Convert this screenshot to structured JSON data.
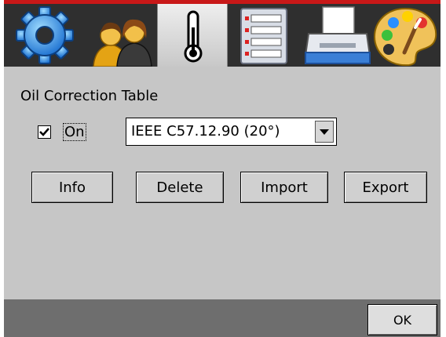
{
  "toolbar": {
    "tabs": [
      {
        "icon": "gear-icon",
        "active": false
      },
      {
        "icon": "users-icon",
        "active": false
      },
      {
        "icon": "thermometer-icon",
        "active": true
      },
      {
        "icon": "list-icon",
        "active": false
      },
      {
        "icon": "printer-icon",
        "active": false
      },
      {
        "icon": "palette-icon",
        "active": false
      }
    ]
  },
  "main": {
    "section_title": "Oil Correction Table",
    "on_checkbox": {
      "label": "On",
      "checked": true
    },
    "standard_select": {
      "value": "IEEE C57.12.90 (20°)"
    },
    "buttons": {
      "info": "Info",
      "delete": "Delete",
      "import": "Import",
      "export": "Export"
    }
  },
  "footer": {
    "ok": "OK"
  },
  "colors": {
    "background": "#c6c6c6",
    "toolbar": "#2f2f2f",
    "accent_red": "#c81818",
    "footer": "#6e6e6e"
  }
}
